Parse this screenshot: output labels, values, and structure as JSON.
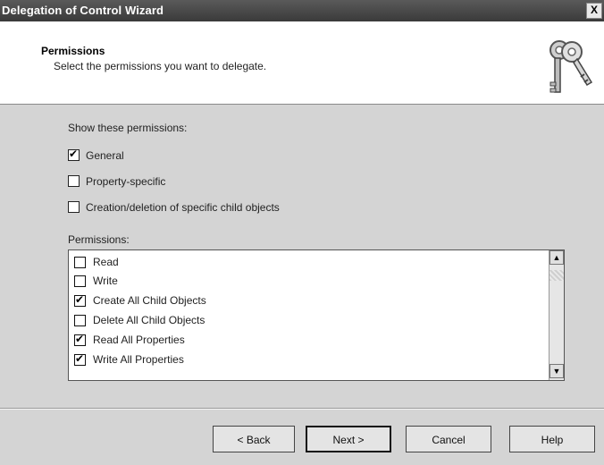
{
  "window": {
    "title": "Delegation of Control Wizard",
    "close_label": "X"
  },
  "header": {
    "title": "Permissions",
    "subtitle": "Select the permissions you want to delegate.",
    "icon": "keys-icon"
  },
  "show": {
    "label": "Show these permissions:",
    "options": [
      {
        "label": "General",
        "checked": true
      },
      {
        "label": "Property-specific",
        "checked": false
      },
      {
        "label": "Creation/deletion of specific child objects",
        "checked": false
      }
    ]
  },
  "permissions": {
    "label": "Permissions:",
    "items": [
      {
        "label": "Read",
        "checked": false
      },
      {
        "label": "Write",
        "checked": false
      },
      {
        "label": "Create All Child Objects",
        "checked": true
      },
      {
        "label": "Delete All Child Objects",
        "checked": false
      },
      {
        "label": "Read All Properties",
        "checked": true
      },
      {
        "label": "Write All Properties",
        "checked": true
      }
    ]
  },
  "buttons": {
    "back": "< Back",
    "next": "Next >",
    "cancel": "Cancel",
    "help": "Help"
  }
}
